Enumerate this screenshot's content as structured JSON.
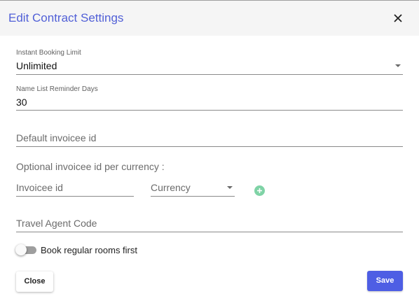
{
  "dialog": {
    "title": "Edit Contract Settings"
  },
  "instant_booking_limit": {
    "label": "Instant Booking Limit",
    "value": "Unlimited"
  },
  "name_list_reminder_days": {
    "label": "Name List Reminder Days",
    "value": "30"
  },
  "default_invoicee": {
    "placeholder": "Default invoicee id"
  },
  "optional_invoicee": {
    "heading": "Optional invoicee id per currency :",
    "invoicee_placeholder": "Invoicee id",
    "currency_placeholder": "Currency"
  },
  "travel_agent_code": {
    "placeholder": "Travel Agent Code"
  },
  "toggle": {
    "label": "Book regular rooms first",
    "on": false
  },
  "buttons": {
    "close": "Close",
    "save": "Save"
  },
  "colors": {
    "accent": "#5160d7",
    "primary_button": "#4e5ee4",
    "add_icon": "#7fd3a6"
  }
}
